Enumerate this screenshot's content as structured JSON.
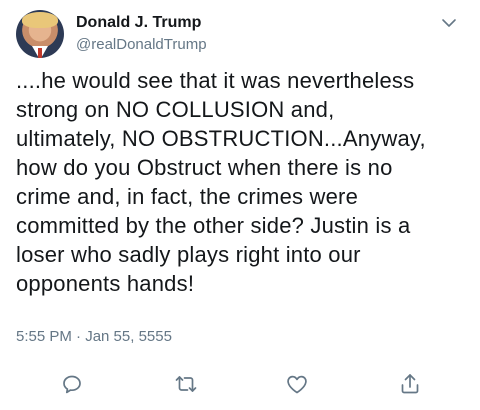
{
  "author": {
    "name": "Donald J. Trump",
    "handle": "@realDonaldTrump"
  },
  "tweet": {
    "text": "....he would see that it was nevertheless\nstrong on NO COLLUSION and,\nultimately, NO OBSTRUCTION...Anyway,\nhow do you Obstruct when there is no\ncrime and, in fact, the crimes were\ncommitted by the other side? Justin is a\nloser who sadly plays right into our\nopponents hands!",
    "timestamp": "5:55 PM · Jan 55, 5555"
  },
  "icons": {
    "menu": "chevron-down-icon",
    "reply": "reply-icon",
    "retweet": "retweet-icon",
    "like": "heart-icon",
    "share": "share-icon"
  },
  "colors": {
    "text": "#14171a",
    "secondary": "#657786",
    "icon": "#657786"
  }
}
